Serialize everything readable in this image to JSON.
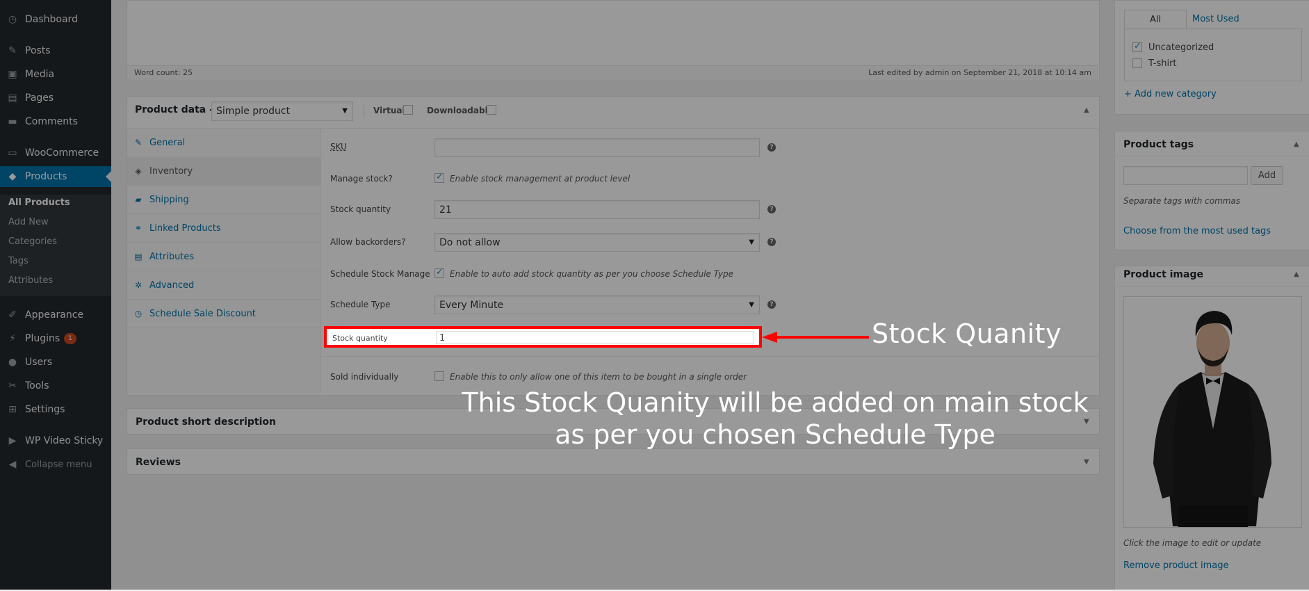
{
  "sidebar": {
    "items": [
      {
        "label": "Dashboard",
        "icon": "dashboard-icon"
      },
      {
        "label": "Posts",
        "icon": "pin-icon"
      },
      {
        "label": "Media",
        "icon": "media-icon"
      },
      {
        "label": "Pages",
        "icon": "pages-icon"
      },
      {
        "label": "Comments",
        "icon": "comments-icon"
      },
      {
        "label": "WooCommerce",
        "icon": "woocommerce-icon"
      },
      {
        "label": "Products",
        "icon": "products-icon"
      },
      {
        "label": "Appearance",
        "icon": "brush-icon"
      },
      {
        "label": "Plugins",
        "icon": "plugin-icon",
        "badge": "1"
      },
      {
        "label": "Users",
        "icon": "users-icon"
      },
      {
        "label": "Tools",
        "icon": "wrench-icon"
      },
      {
        "label": "Settings",
        "icon": "settings-icon"
      },
      {
        "label": "WP Video Sticky",
        "icon": "video-icon"
      },
      {
        "label": "Collapse menu",
        "icon": "collapse-icon"
      }
    ],
    "submenu": [
      "All Products",
      "Add New",
      "Categories",
      "Tags",
      "Attributes"
    ]
  },
  "editor": {
    "word_count": "Word count: 25",
    "last_edited": "Last edited by admin on September 21, 2018 at 10:14 am"
  },
  "product_data": {
    "title": "Product data —",
    "type": "Simple product",
    "virtual_label": "Virtual:",
    "downloadable_label": "Downloadable:",
    "tabs": [
      "General",
      "Inventory",
      "Shipping",
      "Linked Products",
      "Attributes",
      "Advanced",
      "Schedule Sale Discount"
    ],
    "fields": {
      "sku_label": "SKU",
      "sku_value": "",
      "manage_stock_label": "Manage stock?",
      "manage_stock_desc": "Enable stock management at product level",
      "stock_qty_label": "Stock quantity",
      "stock_qty_value": "21",
      "backorders_label": "Allow backorders?",
      "backorders_value": "Do not allow",
      "schedule_manage_label": "Schedule Stock Manage",
      "schedule_manage_desc": "Enable to auto add stock quantity as per you choose Schedule Type",
      "schedule_type_label": "Schedule Type",
      "schedule_type_value": "Every Minute",
      "sched_stock_qty_label": "Stock quantity",
      "sched_stock_qty_value": "1",
      "sold_individually_label": "Sold individually",
      "sold_individually_desc": "Enable this to only allow one of this item to be bought in a single order"
    }
  },
  "short_description": {
    "title": "Product short description"
  },
  "reviews": {
    "title": "Reviews"
  },
  "categories": {
    "tab_all": "All categories",
    "tab_most_used": "Most Used",
    "items": [
      {
        "label": "Uncategorized",
        "checked": true
      },
      {
        "label": "T-shirt",
        "checked": false
      }
    ],
    "add_new": "+ Add new category"
  },
  "tags": {
    "title": "Product tags",
    "add_button": "Add",
    "hint": "Separate tags with commas",
    "choose_link": "Choose from the most used tags"
  },
  "product_image": {
    "title": "Product image",
    "hint": "Click the image to edit or update",
    "remove_link": "Remove product image"
  },
  "annotations": {
    "callout": "Stock Quanity",
    "note_line1": "This Stock Quanity will be added on main stock",
    "note_line2": "as per you chosen Schedule Type",
    "highlight_color": "#ff0000"
  }
}
